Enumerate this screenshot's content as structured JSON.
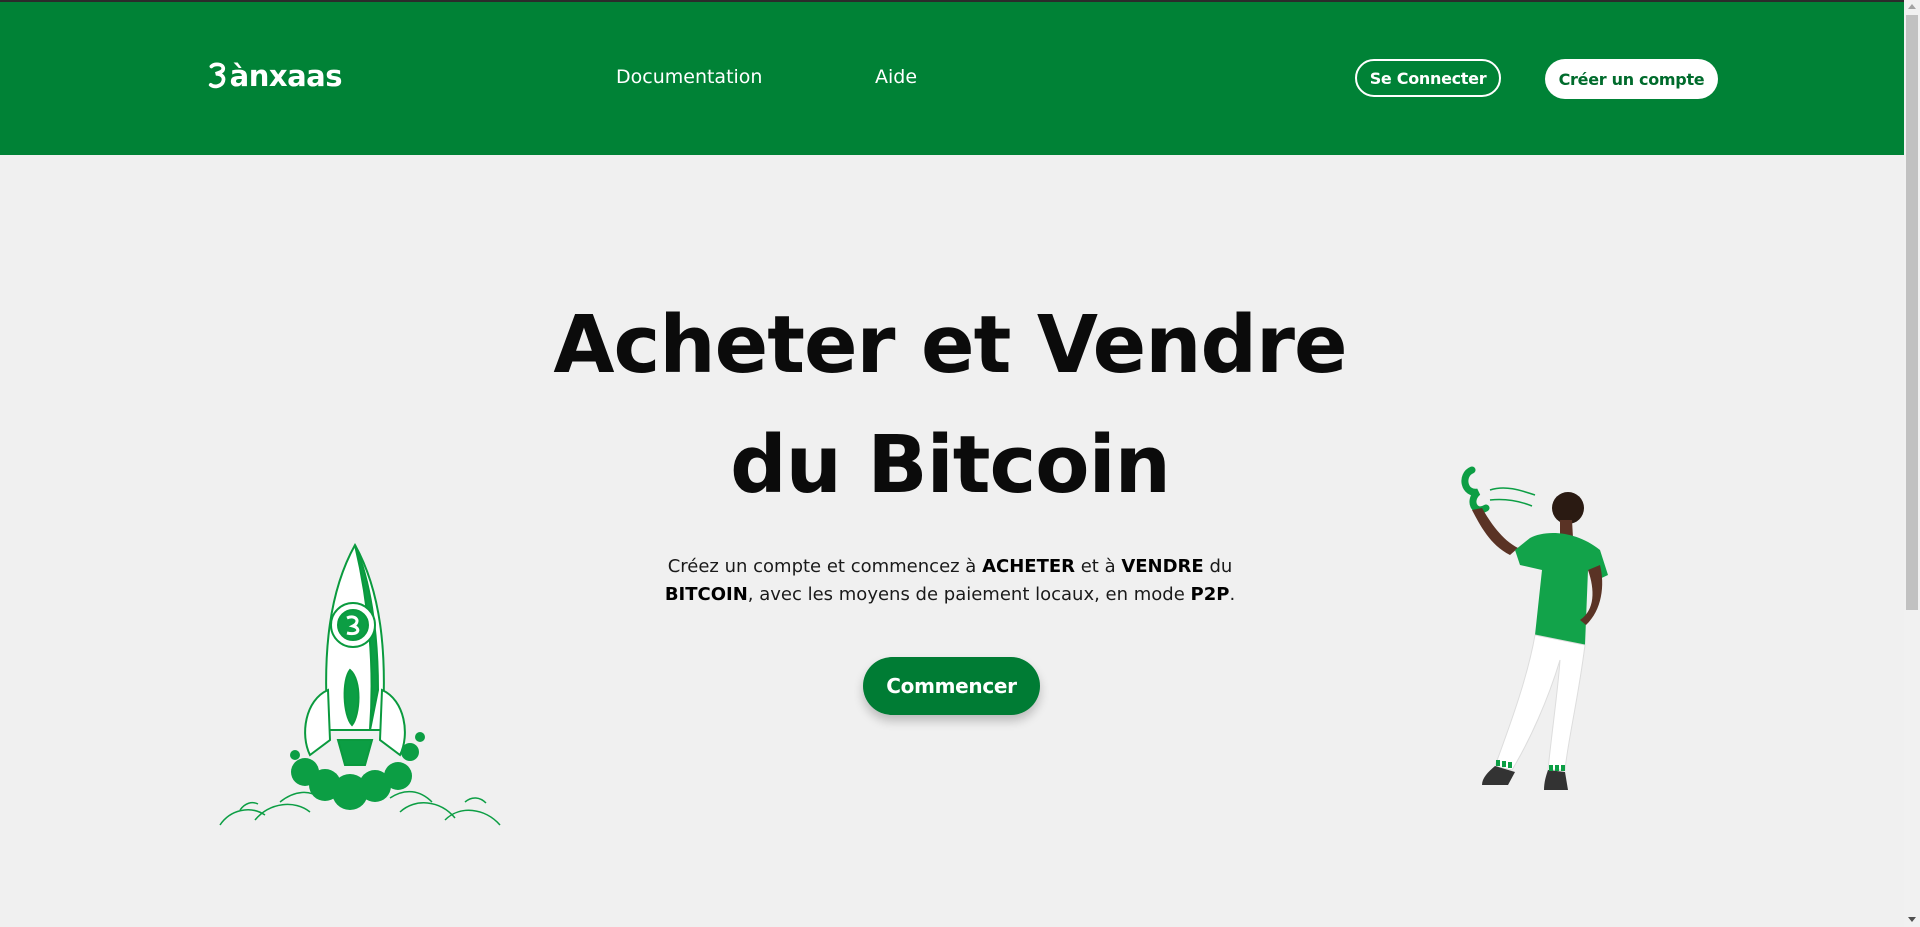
{
  "header": {
    "logo_text": "ànxaas",
    "nav": [
      {
        "label": "Documentation"
      },
      {
        "label": "Aide"
      }
    ],
    "login_label": "Se Connecter",
    "signup_label": "Créer un compte"
  },
  "hero": {
    "title_line1": "Acheter et Vendre",
    "title_line2": "du Bitcoin",
    "subtitle": {
      "p1": "Créez un compte et commencez à ",
      "b1": "ACHETER",
      "p2": " et à ",
      "b2": "VENDRE",
      "p3": " du ",
      "b3": "BITCOIN",
      "p4": ", avec les moyens de paiement locaux, en mode ",
      "b4": "P2P",
      "p5": "."
    },
    "cta_label": "Commencer"
  },
  "colors": {
    "brand_green": "#008236",
    "cta_green": "#007c34",
    "background": "#f0f0f0"
  },
  "icons": {
    "logo_mark": "banxaas-logo-icon",
    "rocket": "rocket-illustration",
    "person": "person-illustration"
  }
}
